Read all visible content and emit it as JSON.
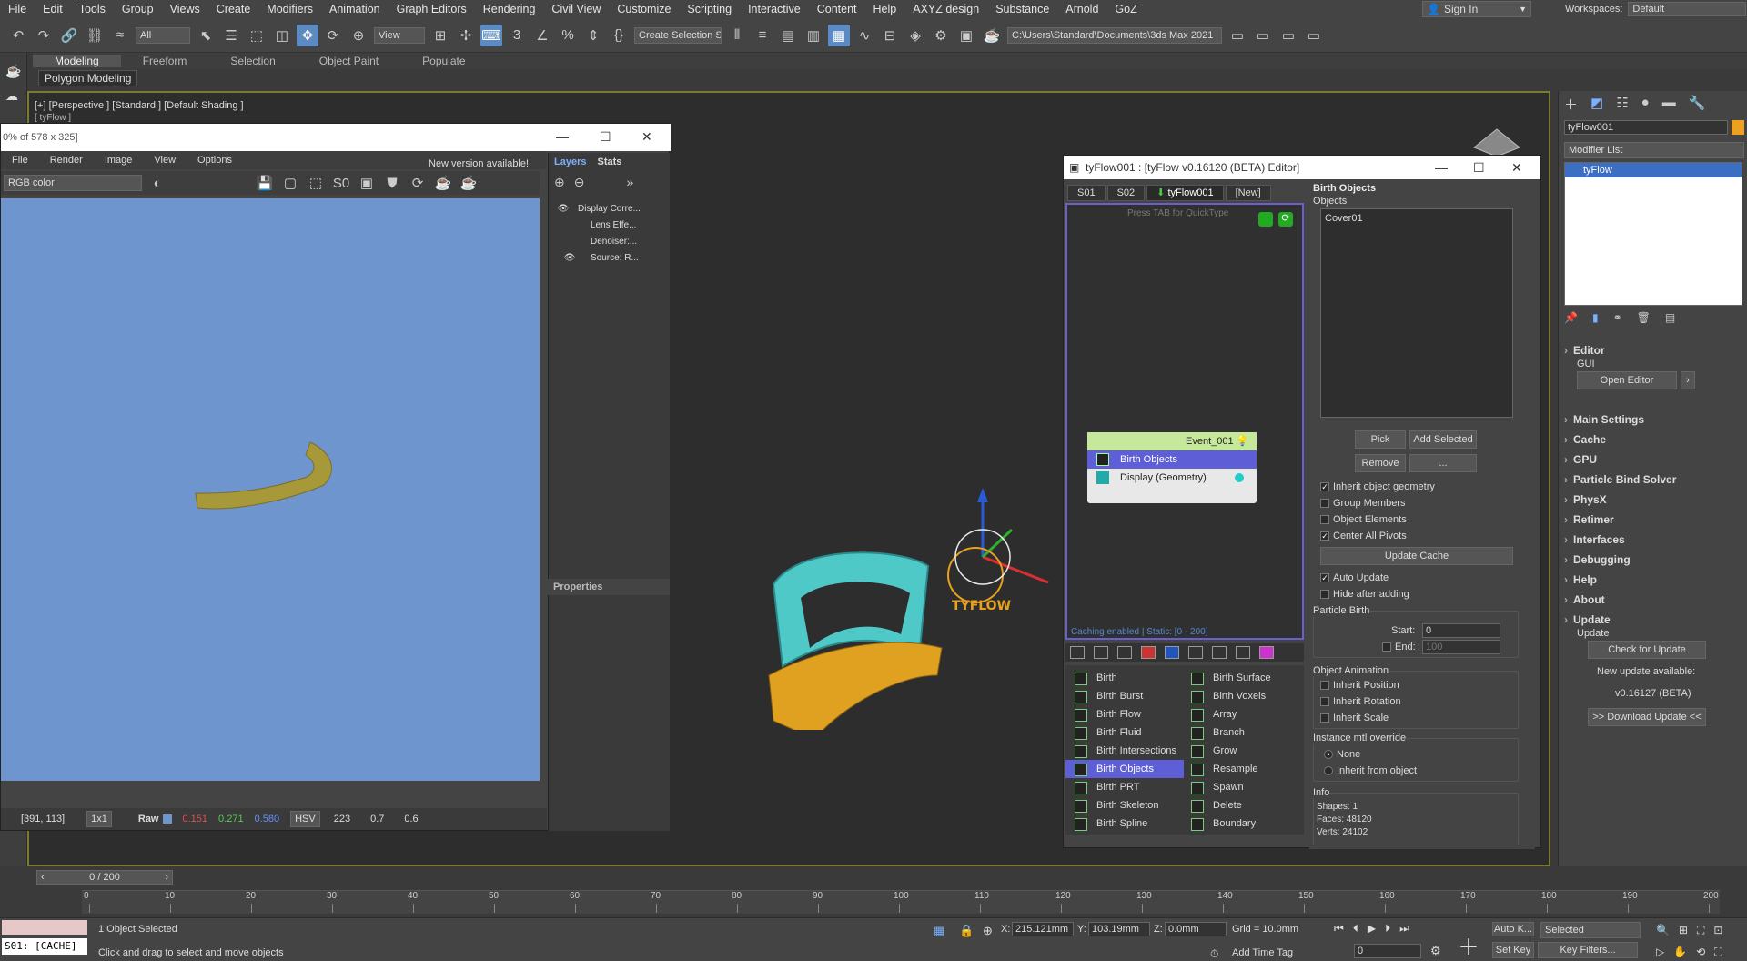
{
  "menubar": {
    "items": [
      "File",
      "Edit",
      "Tools",
      "Group",
      "Views",
      "Create",
      "Modifiers",
      "Animation",
      "Graph Editors",
      "Rendering",
      "Civil View",
      "Customize",
      "Scripting",
      "Interactive",
      "Content",
      "Help",
      "AXYZ design",
      "Substance",
      "Arnold",
      "GoZ"
    ],
    "sign_in": "Sign In",
    "workspaces_label": "Workspaces:",
    "workspace_value": "Default"
  },
  "toolbar": {
    "filter_value": "All",
    "refcoord_value": "View",
    "selection_set_placeholder": "Create Selection Se",
    "project_path": "C:\\Users\\Standard\\Documents\\3ds Max 2021"
  },
  "ribbon": {
    "tabs": [
      "Modeling",
      "Freeform",
      "Selection",
      "Object Paint",
      "Populate"
    ],
    "active_panel": "Polygon Modeling"
  },
  "viewport": {
    "label": "[+] [Perspective ] [Standard ] [Default Shading ]",
    "sublabel": "[ tyFlow ]"
  },
  "frame_buffer": {
    "title": "0% of 578 x 325]",
    "menu": [
      "File",
      "Render",
      "Image",
      "View",
      "Options"
    ],
    "new_version": "New version available!",
    "channel": "RGB color",
    "layers_tab": "Layers",
    "stats_tab": "Stats",
    "layers": [
      "Display Corre...",
      "Lens Effe...",
      "Denoiser:...",
      "Source: R..."
    ],
    "properties": "Properties",
    "status": {
      "coords": "[391, 113]",
      "zoom": "1x1",
      "raw_label": "Raw",
      "r": "0.151",
      "g": "0.271",
      "b": "0.580",
      "mode": "HSV",
      "h": "223",
      "s": "0.7",
      "v": "0.6"
    }
  },
  "tyflow": {
    "title": "tyFlow001 : [tyFlow v0.16120 (BETA) Editor]",
    "tabs": [
      "S01",
      "S02",
      "tyFlow001",
      "[New]"
    ],
    "hint": "Press TAB for QuickType",
    "caching": "Caching enabled | Static: [0 - 200]",
    "event_name": "Event_001",
    "event_ops": [
      "Birth Objects",
      "Display (Geometry)"
    ],
    "ops_left": [
      "Birth",
      "Birth Burst",
      "Birth Flow",
      "Birth Fluid",
      "Birth Intersections",
      "Birth Objects",
      "Birth PRT",
      "Birth Skeleton",
      "Birth Spline"
    ],
    "ops_right": [
      "Birth Surface",
      "Birth Voxels",
      "Array",
      "Branch",
      "Grow",
      "Resample",
      "Spawn",
      "Delete",
      "Boundary"
    ],
    "rollout": {
      "title": "Birth Objects",
      "objects_label": "Objects",
      "object_list": [
        "Cover01"
      ],
      "pick": "Pick",
      "add_selected": "Add Selected",
      "remove": "Remove",
      "more": "...",
      "inherit_geometry": "Inherit object geometry",
      "group_members": "Group Members",
      "object_elements": "Object Elements",
      "center_pivots": "Center All Pivots",
      "update_cache": "Update Cache",
      "auto_update": "Auto Update",
      "hide_after": "Hide after adding",
      "particle_birth": "Particle Birth",
      "start_label": "Start:",
      "start_value": "0",
      "end_label": "End:",
      "end_value": "100",
      "object_animation": "Object Animation",
      "inherit_position": "Inherit Position",
      "inherit_rotation": "Inherit Rotation",
      "inherit_scale": "Inherit Scale",
      "instance_override": "Instance mtl override",
      "none": "None",
      "inherit_from_object": "Inherit from object",
      "info": "Info",
      "shapes": "Shapes: 1",
      "faces": "Faces: 48120",
      "verts": "Verts: 24102"
    }
  },
  "command_panel": {
    "object_name": "tyFlow001",
    "modifier_list": "Modifier List",
    "stack_item": "tyFlow",
    "editor": "Editor",
    "gui": "GUI",
    "open_editor": "Open Editor",
    "sections": [
      "Main Settings",
      "Cache",
      "GPU",
      "Particle Bind Solver",
      "PhysX",
      "Retimer",
      "Interfaces",
      "Debugging",
      "Help",
      "About"
    ],
    "update": "Update",
    "update_sub": "Update",
    "check_update": "Check for Update",
    "new_update": "New update available:",
    "new_version": "v0.16127 (BETA)",
    "download": ">> Download Update <<"
  },
  "timeline": {
    "frame": "0 / 200",
    "ticks": [
      "0",
      "10",
      "20",
      "30",
      "40",
      "50",
      "60",
      "70",
      "80",
      "90",
      "100",
      "110",
      "120",
      "130",
      "140",
      "150",
      "160",
      "170",
      "180",
      "190",
      "200"
    ]
  },
  "status": {
    "script_listener": "S01: [CACHE]",
    "selected": "1 Object Selected",
    "prompt": "Click and drag to select and move objects",
    "x_label": "X:",
    "x": "215.121mm",
    "y_label": "Y:",
    "y": "103.19mm",
    "z_label": "Z:",
    "z": "0.0mm",
    "grid": "Grid = 10.0mm",
    "add_time_tag": "Add Time Tag",
    "auto_key": "Auto K...",
    "set_key": "Set Key",
    "selected_dd": "Selected",
    "key_filters": "Key Filters...",
    "frame_input": "0"
  },
  "colors": {
    "accent": "#5b8bc2",
    "tyflow_logo": "#e8a020",
    "goggle_frame": "#4fc8c8",
    "goggle_strap": "#e0a020",
    "vfb_bg": "#6f95cf",
    "event_header": "#c6e89a",
    "event_select": "#5e5ed6"
  }
}
